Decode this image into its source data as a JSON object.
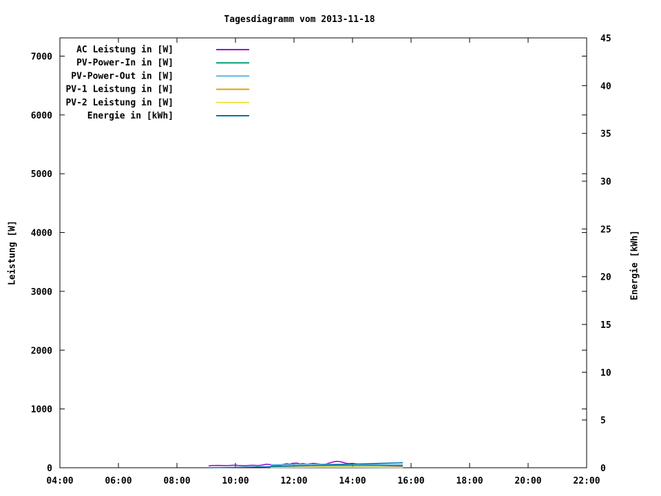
{
  "page": {
    "background": "#ffffff",
    "axis_color": "#000000"
  },
  "chart_data": {
    "type": "line",
    "title": "Tagesdiagramm vom 2013-11-18",
    "xlabel": "",
    "ylabel": "Leistung [W]",
    "y2label": "Energie [kWh]",
    "grid": false,
    "legend_position": "top-left-inside",
    "xlim_hours": [
      4,
      22
    ],
    "x_ticks": [
      {
        "hour": 4,
        "label": "04:00"
      },
      {
        "hour": 6,
        "label": "06:00"
      },
      {
        "hour": 8,
        "label": "08:00"
      },
      {
        "hour": 10,
        "label": "10:00"
      },
      {
        "hour": 12,
        "label": "12:00"
      },
      {
        "hour": 14,
        "label": "14:00"
      },
      {
        "hour": 16,
        "label": "16:00"
      },
      {
        "hour": 18,
        "label": "18:00"
      },
      {
        "hour": 20,
        "label": "20:00"
      },
      {
        "hour": 22,
        "label": "22:00"
      }
    ],
    "ylim": [
      0,
      7310
    ],
    "y_ticks": [
      0,
      1000,
      2000,
      3000,
      4000,
      5000,
      6000,
      7000
    ],
    "y2lim": [
      0,
      45
    ],
    "y2_ticks": [
      0,
      5,
      10,
      15,
      20,
      25,
      30,
      35,
      40,
      45
    ],
    "series": [
      {
        "name": "AC Leistung in [W]",
        "color": "#9400d3",
        "axis": "y",
        "points": [
          [
            9.08,
            30
          ],
          [
            9.2,
            38
          ],
          [
            9.4,
            40
          ],
          [
            9.6,
            38
          ],
          [
            9.8,
            40
          ],
          [
            10.0,
            45
          ],
          [
            10.1,
            40
          ],
          [
            10.3,
            35
          ],
          [
            10.45,
            40
          ],
          [
            10.6,
            42
          ],
          [
            10.75,
            38
          ],
          [
            10.9,
            45
          ],
          [
            11.05,
            60
          ],
          [
            11.15,
            55
          ],
          [
            11.3,
            48
          ],
          [
            11.45,
            40
          ],
          [
            11.6,
            55
          ],
          [
            11.75,
            70
          ],
          [
            11.85,
            60
          ],
          [
            11.95,
            75
          ],
          [
            12.1,
            80
          ],
          [
            12.2,
            65
          ],
          [
            12.3,
            72
          ],
          [
            12.45,
            60
          ],
          [
            12.55,
            68
          ],
          [
            12.65,
            75
          ],
          [
            12.75,
            70
          ],
          [
            12.9,
            62
          ],
          [
            13.0,
            58
          ],
          [
            13.1,
            65
          ],
          [
            13.25,
            85
          ],
          [
            13.35,
            100
          ],
          [
            13.45,
            110
          ],
          [
            13.55,
            105
          ],
          [
            13.65,
            95
          ],
          [
            13.75,
            80
          ],
          [
            13.85,
            70
          ],
          [
            14.0,
            75
          ],
          [
            14.1,
            68
          ],
          [
            14.25,
            60
          ],
          [
            14.4,
            55
          ],
          [
            14.55,
            50
          ],
          [
            14.7,
            42
          ],
          [
            14.9,
            38
          ],
          [
            15.1,
            35
          ],
          [
            15.3,
            32
          ],
          [
            15.5,
            30
          ],
          [
            15.72,
            28
          ]
        ]
      },
      {
        "name": "PV-Power-In in [W]",
        "color": "#009e73",
        "axis": "y",
        "points": [
          [
            11.2,
            30
          ],
          [
            11.8,
            34
          ],
          [
            12.5,
            36
          ],
          [
            13.2,
            38
          ],
          [
            14.0,
            38
          ],
          [
            14.8,
            36
          ],
          [
            15.72,
            36
          ]
        ]
      },
      {
        "name": "PV-Power-Out in [W]",
        "color": "#56b4e9",
        "axis": "y",
        "points": [
          [
            11.2,
            50
          ],
          [
            11.8,
            55
          ],
          [
            12.5,
            58
          ],
          [
            13.2,
            60
          ],
          [
            14.0,
            58
          ],
          [
            14.8,
            55
          ],
          [
            15.72,
            52
          ]
        ]
      },
      {
        "name": "PV-1 Leistung in [W]",
        "color": "#e69f00",
        "axis": "y",
        "points": [
          [
            11.2,
            10
          ],
          [
            12.0,
            12
          ],
          [
            13.0,
            14
          ],
          [
            14.0,
            13
          ],
          [
            15.0,
            11
          ],
          [
            15.72,
            10
          ]
        ]
      },
      {
        "name": "PV-2 Leistung in [W]",
        "color": "#f0e442",
        "axis": "y",
        "points": [
          [
            11.2,
            6
          ],
          [
            12.0,
            7
          ],
          [
            13.0,
            8
          ],
          [
            14.0,
            8
          ],
          [
            15.0,
            7
          ],
          [
            15.72,
            6
          ]
        ]
      },
      {
        "name": "Energie in [kWh]",
        "color": "#0072b2",
        "axis": "y2",
        "points": [
          [
            9.08,
            0.0
          ],
          [
            10.0,
            0.04
          ],
          [
            11.0,
            0.1
          ],
          [
            12.0,
            0.18
          ],
          [
            13.0,
            0.27
          ],
          [
            14.0,
            0.38
          ],
          [
            15.0,
            0.47
          ],
          [
            15.72,
            0.53
          ]
        ]
      }
    ]
  }
}
